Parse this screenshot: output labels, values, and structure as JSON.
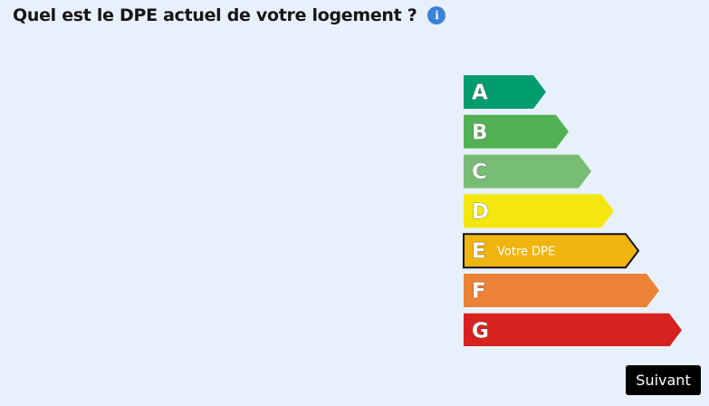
{
  "question": {
    "title": "Quel est le DPE actuel de votre logement ?",
    "info_icon": "info-icon",
    "info_glyph": "i"
  },
  "dpe": {
    "selected": "E",
    "selected_label": "Votre DPE",
    "classes": [
      {
        "letter": "A",
        "color": "#009c6d"
      },
      {
        "letter": "B",
        "color": "#52b153"
      },
      {
        "letter": "C",
        "color": "#78bd76"
      },
      {
        "letter": "D",
        "color": "#f4e70f"
      },
      {
        "letter": "E",
        "color": "#f0b40f"
      },
      {
        "letter": "F",
        "color": "#eb8235"
      },
      {
        "letter": "G",
        "color": "#d7221f"
      }
    ]
  },
  "actions": {
    "next_label": "Suivant"
  }
}
